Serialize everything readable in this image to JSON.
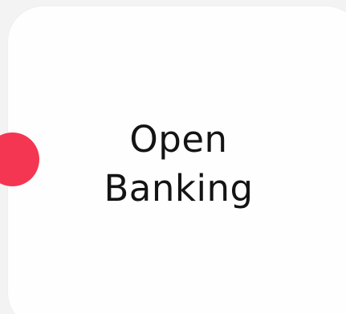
{
  "card": {
    "title_line_1": "Open",
    "title_line_2": "Banking"
  },
  "colors": {
    "background": "#f3f3f3",
    "card": "#fefefe",
    "accent_dot": "#f43653",
    "text": "#141414"
  }
}
